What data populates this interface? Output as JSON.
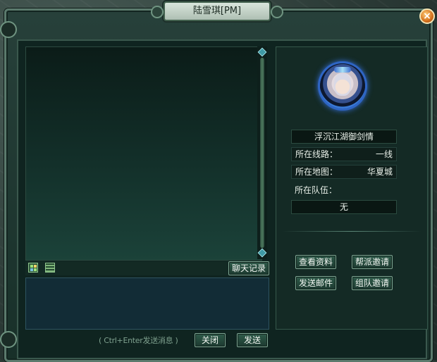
{
  "window": {
    "title": "陆雪琪[PM]",
    "close_icon": "close-icon"
  },
  "chat": {
    "history_button": "聊天记录",
    "hint": "( Ctrl+Enter发送消息 )",
    "close_button": "关闭",
    "send_button": "发送",
    "input_value": "",
    "toolbar_icons": [
      "emote-icon",
      "quick-phrase-icon"
    ]
  },
  "profile": {
    "avatar": "character-portrait",
    "name": "浮沉江湖御剑情",
    "line_label": "所在线路：",
    "line_value": "一线",
    "map_label": "所在地图：",
    "map_value": "华夏城",
    "team_label": "所在队伍：",
    "team_value": "无",
    "buttons": {
      "view_info": "查看资料",
      "guild_invite": "帮派邀请",
      "send_mail": "发送邮件",
      "team_invite": "组队邀请"
    }
  },
  "colors": {
    "accent": "#3e6ed2",
    "close": "#d4701c",
    "panel": "#142a25"
  }
}
